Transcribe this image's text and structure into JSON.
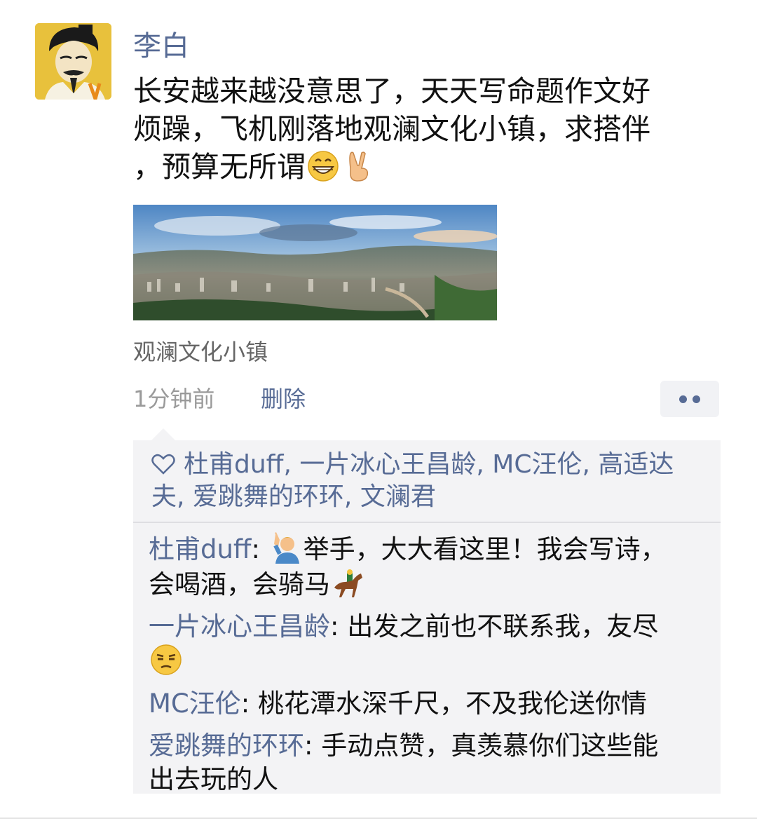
{
  "post": {
    "author": "李白",
    "text_lines": [
      "长安越来越没意思了，天天写命题作文好",
      "烦躁，飞机刚落地观澜文化小镇，求搭伴",
      "，预算无所谓"
    ],
    "text_emojis": [
      "grinning-face-emoji",
      "victory-hand-emoji"
    ],
    "location": "观澜文化小镇",
    "time": "1分钟前",
    "delete_label": "删除"
  },
  "likes": {
    "icon": "heart-icon",
    "line1": [
      "杜甫duff",
      "一片冰心王昌龄",
      "MC汪伦",
      "高适达"
    ],
    "line2": [
      "夫",
      "爱跳舞的环环",
      "文澜君"
    ],
    "separator": ", "
  },
  "comments": [
    {
      "name": "杜甫duff",
      "colon": ": ",
      "emoji": "person-raising-hand-emoji",
      "line1": "举手，大大看这里！我会写诗，",
      "line2": "会喝酒，会骑马",
      "end_emoji": "horse-racing-emoji"
    },
    {
      "name": "一片冰心王昌龄",
      "colon": ": ",
      "line1": "出发之前也不联系我，友尽",
      "end_emoji": "unamused-face-emoji"
    },
    {
      "name": "MC汪伦",
      "colon": ": ",
      "line1": "桃花潭水深千尺，不及我伦送你情"
    },
    {
      "name": "爱跳舞的环环",
      "colon": ": ",
      "line1": "手动点赞，真羡慕你们这些能",
      "line2": "出去玩的人"
    }
  ],
  "colors": {
    "link": "#576b95",
    "panel": "#f3f3f5",
    "meta": "#9a9a9a"
  }
}
